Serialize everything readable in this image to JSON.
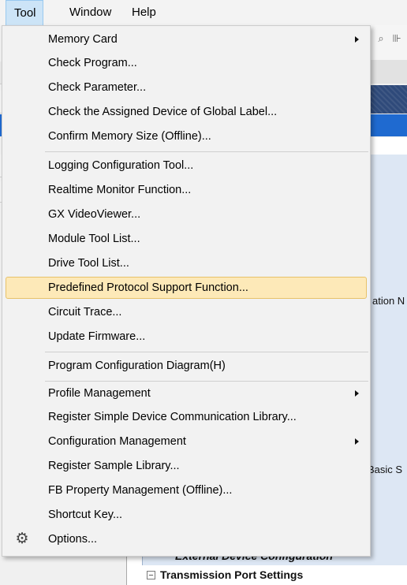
{
  "menubar": {
    "tool": "Tool",
    "window": "Window",
    "help": "Help"
  },
  "background": {
    "frag_station": "ation N",
    "frag_basic": "Basic S",
    "external_device": "External Device Configuration",
    "transmission_port": "Transmission Port Settings",
    "tps_expander": "−"
  },
  "tool_menu": {
    "items": [
      {
        "label": "Memory Card",
        "submenu": true
      },
      {
        "label": "Check Program..."
      },
      {
        "label": "Check Parameter..."
      },
      {
        "label": "Check the Assigned Device of Global Label..."
      },
      {
        "label": "Confirm Memory Size (Offline)..."
      },
      {
        "label": "Logging Configuration Tool..."
      },
      {
        "label": "Realtime Monitor Function..."
      },
      {
        "label": "GX VideoViewer..."
      },
      {
        "label": "Module Tool List..."
      },
      {
        "label": "Drive Tool List..."
      },
      {
        "label": "Predefined Protocol Support Function...",
        "highlighted": true
      },
      {
        "label": "Circuit Trace..."
      },
      {
        "label": "Update Firmware..."
      },
      {
        "label": "Program Configuration Diagram(H)"
      },
      {
        "label": "Profile Management",
        "submenu": true
      },
      {
        "label": "Register Simple Device Communication Library..."
      },
      {
        "label": "Configuration Management",
        "submenu": true
      },
      {
        "label": "Register Sample Library..."
      },
      {
        "label": "FB Property Management (Offline)..."
      },
      {
        "label": "Shortcut Key..."
      },
      {
        "label": "Options...",
        "icon": "gear-icon"
      }
    ]
  },
  "icons": {
    "zoom": "zoom-icon",
    "toolbar_btn": "toolbar-button-icon",
    "submenu_arrow": "chevron-right-icon",
    "options": "gear-icon"
  },
  "colors": {
    "highlight_bg": "#fde9b8",
    "highlight_border": "#e7c26a",
    "menu_bg": "#f2f2f2",
    "menubar_open": "#cce4f7",
    "selection_blue": "#1f6ad0",
    "navy": "#2f4a7a"
  }
}
